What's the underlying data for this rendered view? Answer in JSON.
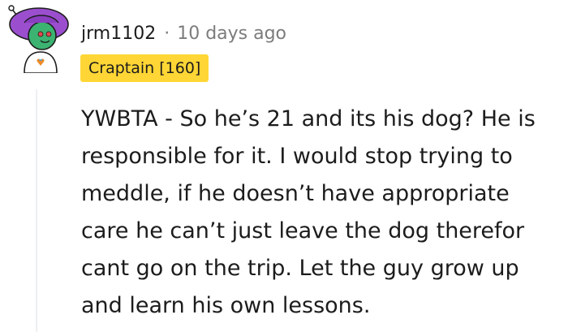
{
  "comment": {
    "author": "jrm1102",
    "separator": "·",
    "timestamp": "10 days ago",
    "flair": "Craptain [160]",
    "avatar_icon": "snoo-avatar-icon",
    "body_lines": [
      "YWBTA - So he’s 21 and its his dog? He is",
      "responsible for it. I would stop trying to",
      "meddle, if he doesn’t have appropriate",
      "care he can’t just leave the dog therefor",
      "cant go on the trip. Let the guy grow up",
      "and learn his own lessons."
    ]
  },
  "colors": {
    "flair_background": "#ffd635",
    "avatar_hat": "#9b4fcf",
    "avatar_head": "#3cb371",
    "muted_text": "#7c7c7c"
  }
}
